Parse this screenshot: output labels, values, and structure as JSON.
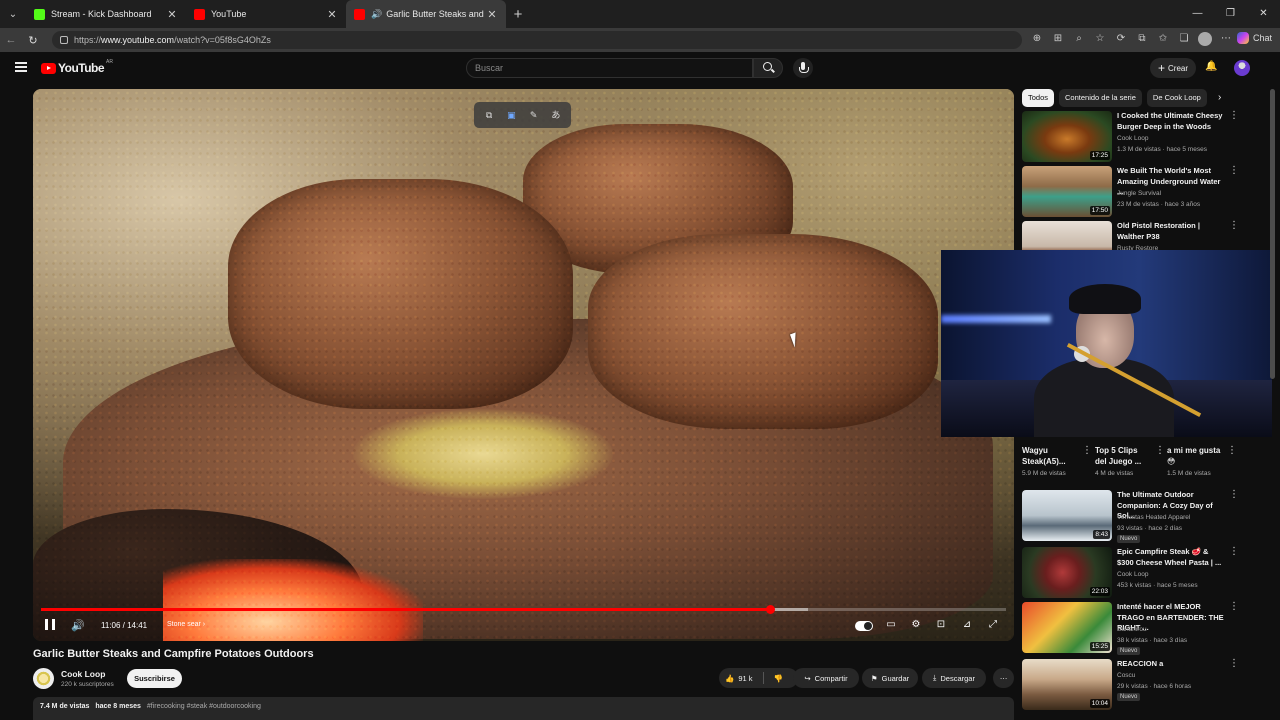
{
  "browser": {
    "tabs": [
      {
        "label": "Stream - Kick Dashboard",
        "fav_color": "#53fc18",
        "active": false
      },
      {
        "label": "YouTube",
        "fav_color": "#ff0000",
        "active": false
      },
      {
        "label": "Garlic Butter Steaks and Camp",
        "fav_color": "#ff0000",
        "active": true
      }
    ],
    "url_prefix": "https://",
    "url_host": "www.youtube.com",
    "url_path": "/watch?v=05f8sG4OhZs",
    "chat_label": "Chat"
  },
  "youtube": {
    "logo_text": "YouTube",
    "region": "AR",
    "search_placeholder": "Buscar",
    "create_label": "Crear"
  },
  "player": {
    "time": "11:06 / 14:41",
    "chapter": "Stone sear",
    "progress": 0.755,
    "buffered": 0.795
  },
  "video": {
    "title": "Garlic Butter Steaks and Campfire Potatoes Outdoors",
    "channel": "Cook Loop",
    "subscribers": "220 k suscriptores",
    "subscribe_label": "Suscribirse",
    "likes": "91 k",
    "share_label": "Compartir",
    "save_label": "Guardar",
    "download_label": "Descargar",
    "views": "7.4 M de vistas",
    "age": "hace 8 meses",
    "tags": "#firecooking #steak #outdoorcooking"
  },
  "sidebar": {
    "chips": [
      "Todos",
      "Contenido de la serie",
      "De Cook Loop"
    ],
    "recs": [
      {
        "title": "I Cooked the Ultimate Cheesy Burger Deep in the Woods",
        "channel": "Cook Loop",
        "meta": "1.3 M de vistas · hace 5 meses",
        "duration": "17:25",
        "badge": ""
      },
      {
        "title": "We Built The World's Most Amazing Underground Water ...",
        "channel": "Jungle Survival",
        "meta": "23 M de vistas · hace 3 años",
        "duration": "17:50",
        "badge": ""
      },
      {
        "title": "Old Pistol Restoration | Walther P38",
        "channel": "Rusty Restore",
        "meta": "",
        "duration": "",
        "badge": ""
      }
    ],
    "shorts": [
      {
        "title": "Wagyu Steak(A5)...",
        "views": "5.9 M de vistas"
      },
      {
        "title": "Top 5 Clips del Juego ...",
        "views": "4 M de vistas"
      },
      {
        "title": "a mi me gusta 😳",
        "views": "1.5 M de vistas"
      }
    ],
    "recs2": [
      {
        "title": "The Ultimate Outdoor Companion: A Cozy Day of Sol...",
        "channel": "Venustas Heated Apparel",
        "meta": "93 vistas · hace 2 días",
        "duration": "8:43",
        "badge": "Nuevo"
      },
      {
        "title": "Epic Campfire Steak 🥩 & $300 Cheese Wheel Pasta | ...",
        "channel": "Cook Loop",
        "meta": "453 k vistas · hace 5 meses",
        "duration": "22:03",
        "badge": ""
      },
      {
        "title": "Intenté hacer el MEJOR TRAGO en BARTENDER: THE RIGHT ...",
        "channel": "Bananirou",
        "meta": "38 k vistas · hace 3 días",
        "duration": "15:25",
        "badge": "Nuevo"
      },
      {
        "title": "REACCION a",
        "channel": "Coscu",
        "meta": "29 k vistas · hace 6 horas",
        "duration": "10:04",
        "badge": "Nuevo"
      }
    ]
  }
}
